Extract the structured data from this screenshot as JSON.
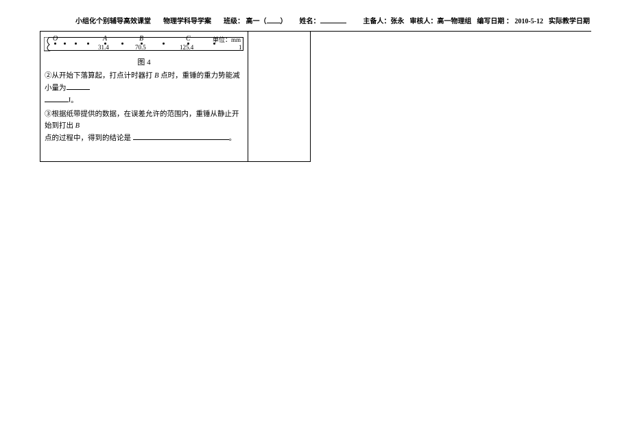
{
  "header": {
    "left": {
      "org": "小组化个别辅导高效课堂",
      "subject": "物理学科导学案",
      "class_label": "班级：",
      "class_value_prefix": "高一（",
      "class_value_suffix": "）",
      "name_label": "姓名："
    },
    "right": {
      "preparer_label": "主备人：",
      "preparer": "张永",
      "reviewer_label": "审核人：",
      "reviewer": "高一物理组",
      "date_label": "编写日期 ：",
      "date": "2010-5-12",
      "actual_label": "实际教学日期"
    }
  },
  "diagram": {
    "o_label": "O",
    "a_label": "A",
    "b_label": "B",
    "c_label": "C",
    "a_val": "31.4",
    "b_val": "70.5",
    "c_val": "125.4",
    "edge_val": "1",
    "unit": "单位：mm",
    "caption": "图 4"
  },
  "para2_prefix": "②从开始下落算起，打点计时器打",
  "para2_bpoint": " B ",
  "para2_mid": "点时，重锤的重力势能减小量为",
  "para2_unit": "J。",
  "para3_prefix": "③根据纸带提供的数据，在误差允许的范围内，重锤从静止开始到打出",
  "para3_bpoint": " B ",
  "para3_mid": "点的过程中，得到的结论是",
  "para3_end": "。"
}
